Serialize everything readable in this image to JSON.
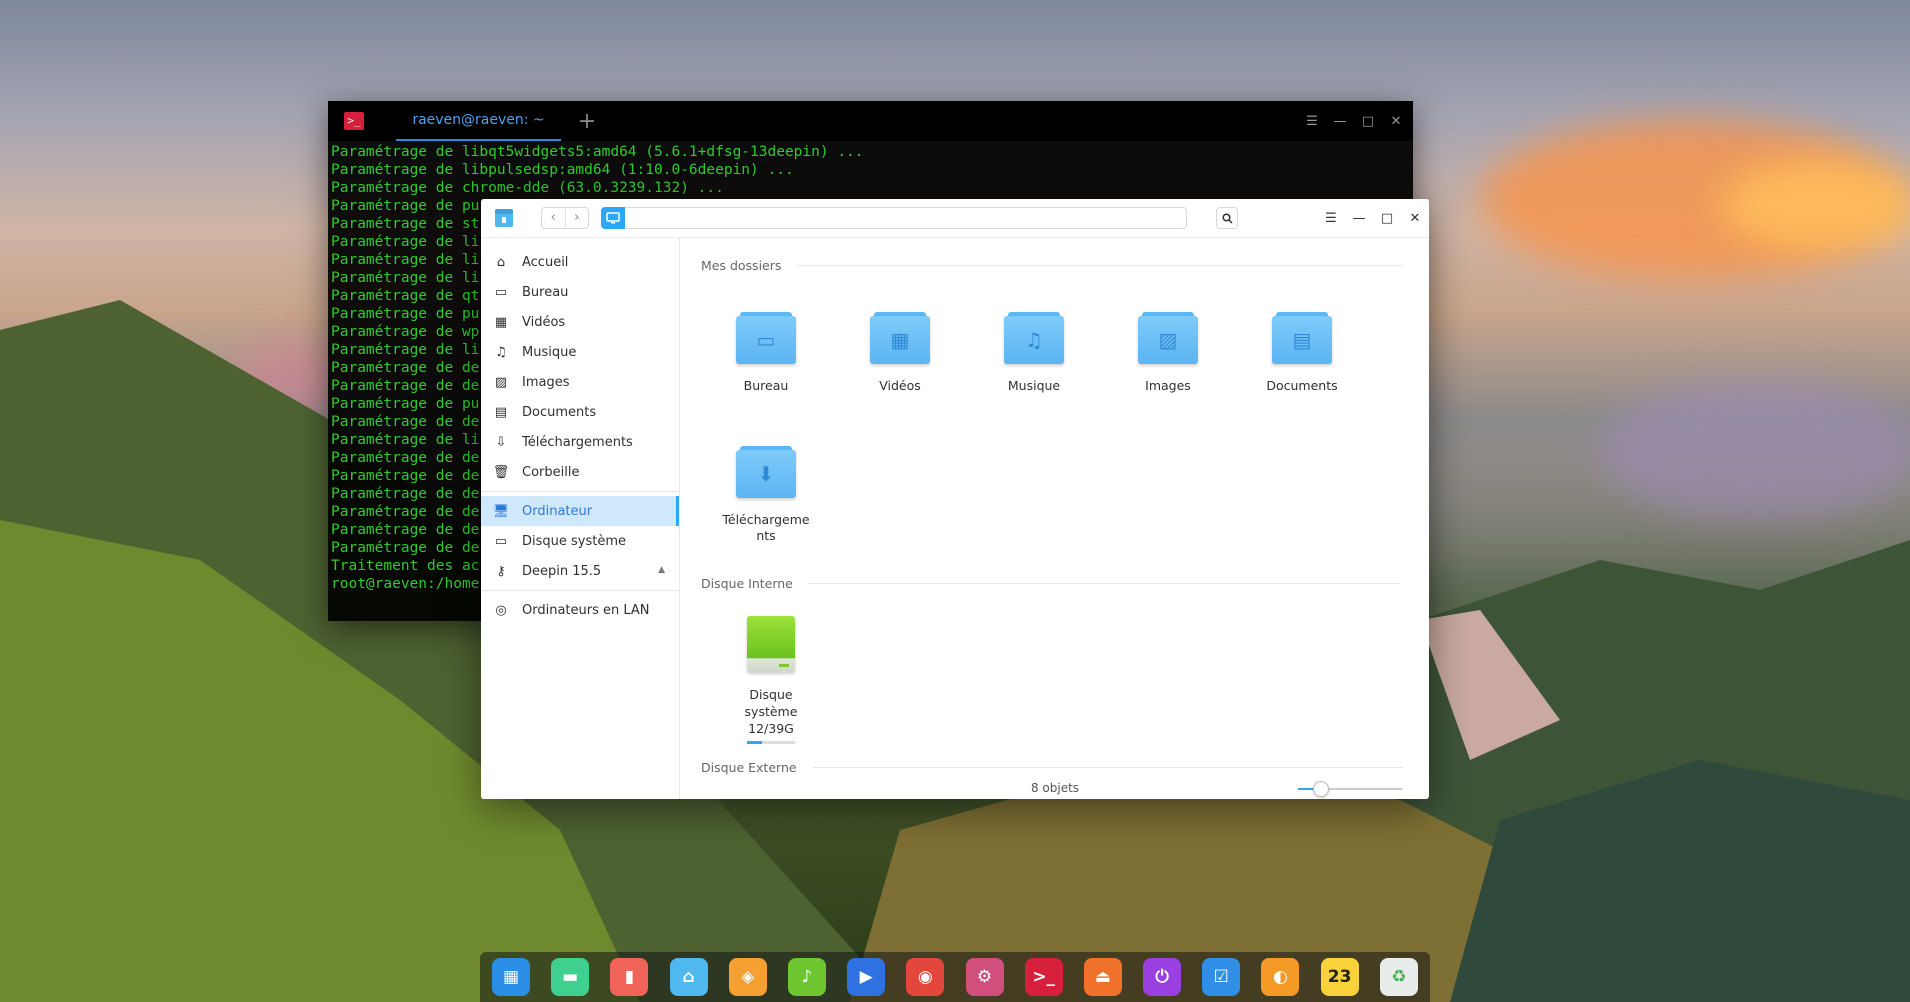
{
  "terminal": {
    "tab_title": "raeven@raeven: ~",
    "plus": "+",
    "controls": [
      "☰",
      "—",
      "□",
      "✕"
    ],
    "lines": [
      "Paramétrage de libqt5widgets5:amd64 (5.6.1+dfsg-13deepin) ...",
      "Paramétrage de libpulsedsp:amd64 (1:10.0-6deepin) ...",
      "Paramétrage de chrome-dde (63.0.3239.132) ...",
      "Paramétrage de pu",
      "Paramétrage de st",
      "Paramétrage de li",
      "Paramétrage de li",
      "Paramétrage de li",
      "Paramétrage de qt",
      "Paramétrage de pu",
      "Paramétrage de wp",
      "Paramétrage de li",
      "Paramétrage de de",
      "Paramétrage de de",
      "Paramétrage de pu",
      "Paramétrage de de",
      "Paramétrage de li",
      "Paramétrage de de",
      "Paramétrage de de",
      "Paramétrage de de",
      "Paramétrage de de",
      "Paramétrage de de",
      "Paramétrage de de",
      "Traitement des ac",
      "root@raeven:/home"
    ]
  },
  "file_manager": {
    "nav_back": "‹",
    "nav_forward": "›",
    "address_value": "",
    "controls": [
      "☰",
      "—",
      "□",
      "✕"
    ],
    "sidebar": [
      {
        "label": "Accueil",
        "icon": "home-icon",
        "glyph": "⌂"
      },
      {
        "label": "Bureau",
        "icon": "desktop-icon",
        "glyph": "▭"
      },
      {
        "label": "Vidéos",
        "icon": "film-icon",
        "glyph": "▦"
      },
      {
        "label": "Musique",
        "icon": "music-note-icon",
        "glyph": "♫"
      },
      {
        "label": "Images",
        "icon": "image-icon",
        "glyph": "▨"
      },
      {
        "label": "Documents",
        "icon": "document-icon",
        "glyph": "▤"
      },
      {
        "label": "Téléchargements",
        "icon": "download-icon",
        "glyph": "⇩"
      },
      {
        "label": "Corbeille",
        "icon": "trash-icon",
        "glyph": "🗑"
      },
      {
        "label": "Ordinateur",
        "icon": "computer-icon",
        "glyph": "🖥"
      },
      {
        "label": "Disque système",
        "icon": "drive-icon",
        "glyph": "▭"
      },
      {
        "label": "Deepin 15.5",
        "icon": "usb-icon",
        "glyph": "⚷"
      },
      {
        "label": "Ordinateurs en LAN",
        "icon": "network-icon",
        "glyph": "◎"
      }
    ],
    "eject": "▲",
    "sections": {
      "my_folders": "Mes dossiers",
      "internal_disk": "Disque Interne",
      "external_disk": "Disque Externe"
    },
    "folders": [
      {
        "label": "Bureau",
        "glyph": "▭"
      },
      {
        "label": "Vidéos",
        "glyph": "▦"
      },
      {
        "label": "Musique",
        "glyph": "♫"
      },
      {
        "label": "Images",
        "glyph": "▨"
      },
      {
        "label": "Documents",
        "glyph": "▤"
      },
      {
        "label_1": "Téléchargeme",
        "label_2": "nts",
        "glyph": "⬇"
      }
    ],
    "disk": {
      "label_1": "Disque",
      "label_2": "système",
      "usage": "12/39G",
      "used_fraction": 0.31
    },
    "status": {
      "count": "8 objets",
      "zoom_fraction": 0.22
    }
  },
  "dock": {
    "items": [
      {
        "name": "launcher-icon",
        "bg": "#2a8de6",
        "glyph": "▦"
      },
      {
        "name": "multitasking-icon",
        "bg": "#3fcf8e",
        "glyph": "▬"
      },
      {
        "name": "screen-recorder-icon",
        "bg": "#f0645a",
        "glyph": "▮"
      },
      {
        "name": "file-manager-icon",
        "bg": "#4fb8ee",
        "glyph": "⌂"
      },
      {
        "name": "app-store-icon",
        "bg": "#f5a030",
        "glyph": "◈"
      },
      {
        "name": "music-player-icon",
        "bg": "#6dc630",
        "glyph": "♪"
      },
      {
        "name": "video-player-icon",
        "bg": "#2f71e0",
        "glyph": "▶"
      },
      {
        "name": "chrome-icon",
        "bg": "#e3463a",
        "glyph": "◉"
      },
      {
        "name": "settings-icon",
        "bg": "#d14f7d",
        "glyph": "⚙"
      },
      {
        "name": "terminal-icon",
        "bg": "#d61f3a",
        "glyph": ">_"
      },
      {
        "name": "installer-icon",
        "bg": "#f0712a",
        "glyph": "⏏"
      },
      {
        "name": "power-icon",
        "bg": "#9a3fe0",
        "glyph": "⏻"
      },
      {
        "name": "system-monitor-icon",
        "bg": "#2f8ee6",
        "glyph": "☑"
      },
      {
        "name": "browser-icon",
        "bg": "#f59a26",
        "glyph": "◐"
      },
      {
        "name": "clock-icon",
        "bg": "#f7d23a",
        "glyph": "23"
      },
      {
        "name": "trash-icon",
        "bg": "#e8ecea",
        "glyph": "♻"
      }
    ]
  }
}
